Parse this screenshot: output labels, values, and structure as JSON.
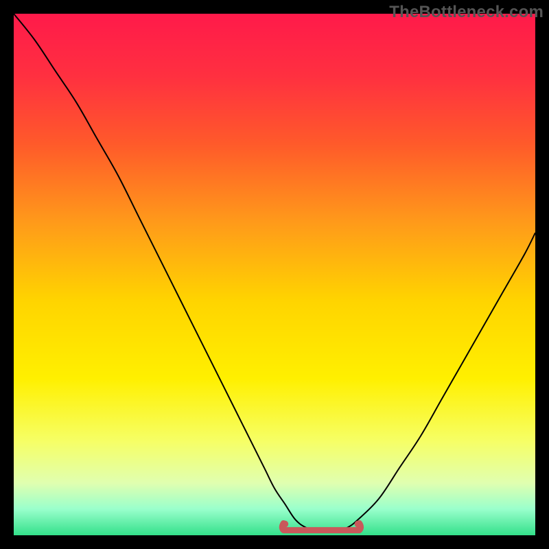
{
  "watermark": "TheBottleneck.com",
  "chart_data": {
    "type": "line",
    "title": "",
    "xlabel": "",
    "ylabel": "",
    "xlim": [
      0,
      100
    ],
    "ylim": [
      0,
      100
    ],
    "background_gradient": {
      "stops": [
        {
          "offset": 0.0,
          "color": "#ff1a4a"
        },
        {
          "offset": 0.12,
          "color": "#ff3040"
        },
        {
          "offset": 0.25,
          "color": "#ff5a2a"
        },
        {
          "offset": 0.4,
          "color": "#ff9a1a"
        },
        {
          "offset": 0.55,
          "color": "#ffd400"
        },
        {
          "offset": 0.7,
          "color": "#fff000"
        },
        {
          "offset": 0.82,
          "color": "#f6ff66"
        },
        {
          "offset": 0.9,
          "color": "#e0ffb0"
        },
        {
          "offset": 0.95,
          "color": "#99ffcc"
        },
        {
          "offset": 1.0,
          "color": "#33e08a"
        }
      ]
    },
    "series": [
      {
        "name": "bottleneck-curve",
        "color": "#000000",
        "x": [
          0,
          4,
          8,
          12,
          16,
          20,
          24,
          28,
          32,
          36,
          40,
          44,
          48,
          50,
          52,
          54,
          56,
          58,
          60,
          62,
          64,
          66,
          70,
          74,
          78,
          82,
          86,
          90,
          94,
          98,
          100
        ],
        "y": [
          100,
          95,
          89,
          83,
          76,
          69,
          61,
          53,
          45,
          37,
          29,
          21,
          13,
          9,
          6,
          3,
          1.5,
          1.0,
          1.0,
          1.0,
          1.5,
          3,
          7,
          13,
          19,
          26,
          33,
          40,
          47,
          54,
          58
        ]
      }
    ],
    "bottom_marker": {
      "name": "optimal-range",
      "color": "#c9595b",
      "x_start": 52,
      "x_end": 66,
      "y": 1.5
    }
  }
}
